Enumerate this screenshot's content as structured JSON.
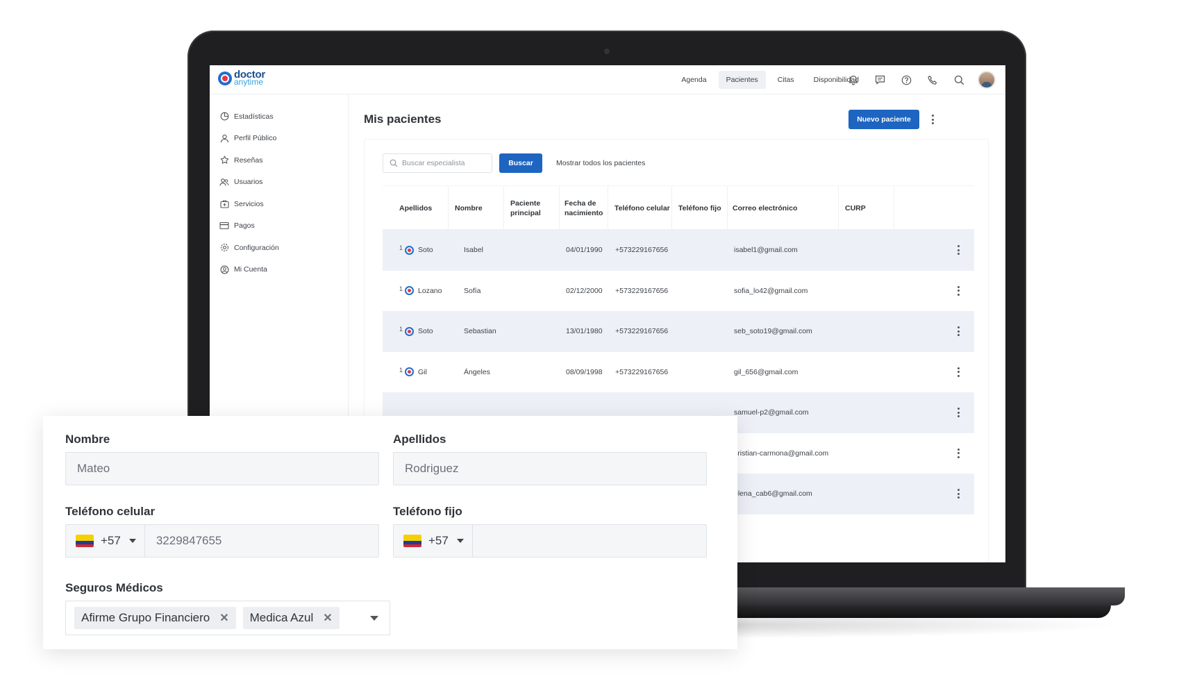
{
  "brand": {
    "logo_line1": "doctor",
    "logo_line2": "anytime"
  },
  "nav": {
    "items": [
      "Agenda",
      "Pacientes",
      "Citas",
      "Disponibilidad"
    ],
    "active": "Pacientes"
  },
  "sidebar": {
    "items": [
      {
        "label": "Estadísticas",
        "icon": "chart-icon"
      },
      {
        "label": "Perfil Público",
        "icon": "user-icon"
      },
      {
        "label": "Reseñas",
        "icon": "star-icon"
      },
      {
        "label": "Usuarios",
        "icon": "users-icon"
      },
      {
        "label": "Servicios",
        "icon": "medkit-icon"
      },
      {
        "label": "Pagos",
        "icon": "card-icon"
      },
      {
        "label": "Configuración",
        "icon": "gear-icon"
      },
      {
        "label": "Mi Cuenta",
        "icon": "account-icon"
      }
    ]
  },
  "main": {
    "title": "Mis pacientes",
    "new_patient_label": "Nuevo paciente",
    "search_placeholder": "Buscar especialista",
    "search_button": "Buscar",
    "show_all": "Mostrar todos los pacientes"
  },
  "table": {
    "headers": [
      "Apellidos",
      "Nombre",
      "Paciente principal",
      "Fecha de nacimiento",
      "Teléfono celular",
      "Teléfono fijo",
      "Correo electrónico",
      "CURP"
    ],
    "rows": [
      {
        "rank": "1",
        "apellidos": "Soto",
        "nombre": "Isabel",
        "fecha": "04/01/1990",
        "celular": "+573229167656",
        "email": "isabel1@gmail.com"
      },
      {
        "rank": "1",
        "apellidos": "Lozano",
        "nombre": "Sofía",
        "fecha": "02/12/2000",
        "celular": "+573229167656",
        "email": "sofia_lo42@gmail.com"
      },
      {
        "rank": "1",
        "apellidos": "Soto",
        "nombre": "Sebastian",
        "fecha": "13/01/1980",
        "celular": "+573229167656",
        "email": "seb_soto19@gmail.com"
      },
      {
        "rank": "1",
        "apellidos": "Gil",
        "nombre": "Ángeles",
        "fecha": "08/09/1998",
        "celular": "+573229167656",
        "email": "gil_656@gmail.com"
      },
      {
        "email": "samuel-p2@gmail.com"
      },
      {
        "email": "cristian-carmona@gmail.com"
      },
      {
        "email": "elena_cab6@gmail.com"
      }
    ]
  },
  "form": {
    "nombre_label": "Nombre",
    "nombre_value": "Mateo",
    "apellidos_label": "Apellidos",
    "apellidos_value": "Rodriguez",
    "celular_label": "Teléfono celular",
    "celular_code": "+57",
    "celular_value": "3229847655",
    "fijo_label": "Teléfono fijo",
    "fijo_code": "+57",
    "fijo_value": "",
    "seguros_label": "Seguros Médicos",
    "seguros_chips": [
      "Afirme Grupo Financiero",
      "Medica Azul"
    ],
    "chip_remove": "✕"
  },
  "colors": {
    "primary": "#1d65c1",
    "row_shade": "#edf1f7",
    "brand_red": "#e8344a"
  }
}
